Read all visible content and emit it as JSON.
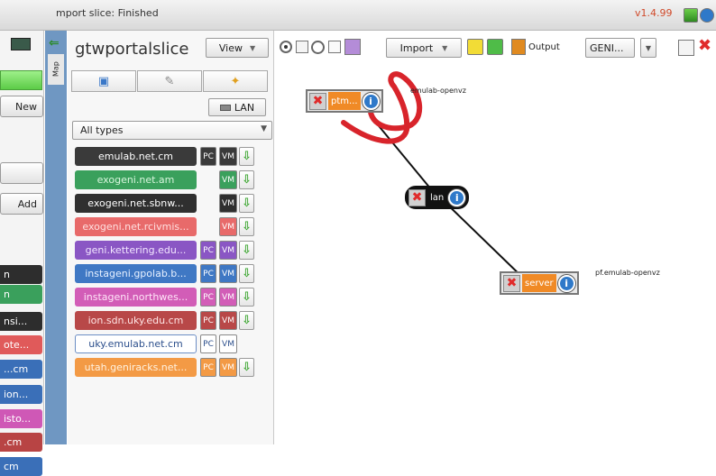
{
  "titlebar": {
    "title": "mport slice: Finished",
    "version": "v1.4.99"
  },
  "left_panel": {
    "new_label": "New",
    "add_label": "Add",
    "chips": [
      {
        "label": "n",
        "color": "#2d2d2d"
      },
      {
        "label": "n",
        "color": "#3aa05c"
      },
      {
        "label": "nsi...",
        "color": "#2d2d2d"
      },
      {
        "label": "ote...",
        "color": "#e05a5a"
      },
      {
        "label": "...cm",
        "color": "#3a6fb8"
      },
      {
        "label": "ion...",
        "color": "#3a6fb8"
      },
      {
        "label": "isto...",
        "color": "#cf58b6"
      },
      {
        "label": ".cm",
        "color": "#b84444"
      },
      {
        "label": "cm",
        "color": "#3a6fb8"
      }
    ]
  },
  "map_strip": {
    "label": "Map"
  },
  "slice_panel": {
    "slice_name": "gtwportalslice",
    "lan_label": "LAN",
    "type_filter": "All types",
    "aggregates": [
      {
        "name": "emulab.net.cm",
        "bg": "#3a3a3a",
        "fg": "#ffffff",
        "pc": "PC",
        "vm": "VM",
        "pc_bg": "#3a3a3a",
        "vm_bg": "#3a3a3a",
        "add": true
      },
      {
        "name": "exogeni.net.am",
        "bg": "#3aa05c",
        "fg": "#d8f5dd",
        "pc": "",
        "vm": "VM",
        "pc_bg": "",
        "vm_bg": "#3aa05c",
        "add": true
      },
      {
        "name": "exogeni.net.sbnw...",
        "bg": "#2f2f2f",
        "fg": "#ffffff",
        "pc": "",
        "vm": "VM",
        "pc_bg": "",
        "vm_bg": "#2f2f2f",
        "add": true
      },
      {
        "name": "exogeni.net.rcivmis...",
        "bg": "#e86a6a",
        "fg": "#ffe0e0",
        "pc": "",
        "vm": "VM",
        "pc_bg": "",
        "vm_bg": "#e86a6a",
        "add": true
      },
      {
        "name": "geni.kettering.edu...",
        "bg": "#8a56c4",
        "fg": "#f2e6ff",
        "pc": "PC",
        "vm": "VM",
        "pc_bg": "#8a56c4",
        "vm_bg": "#8a56c4",
        "add": true
      },
      {
        "name": "instageni.gpolab.b...",
        "bg": "#3f78c4",
        "fg": "#e6f0ff",
        "pc": "PC",
        "vm": "VM",
        "pc_bg": "#3f78c4",
        "vm_bg": "#3f78c4",
        "add": true
      },
      {
        "name": "instageni.northwes...",
        "bg": "#d25db7",
        "fg": "#ffe6f8",
        "pc": "PC",
        "vm": "VM",
        "pc_bg": "#d25db7",
        "vm_bg": "#d25db7",
        "add": true
      },
      {
        "name": "ion.sdn.uky.edu.cm",
        "bg": "#b84848",
        "fg": "#ffe6e6",
        "pc": "PC",
        "vm": "VM",
        "pc_bg": "#b84848",
        "vm_bg": "#b84848",
        "add": true
      },
      {
        "name": "uky.emulab.net.cm",
        "bg": "#ffffff",
        "fg": "#2c4f8c",
        "pc": "PC",
        "vm": "VM",
        "pc_bg": "#ffffff",
        "vm_bg": "#ffffff",
        "add": false
      },
      {
        "name": "utah.geniracks.net...",
        "bg": "#f39a45",
        "fg": "#fff2e0",
        "pc": "PC",
        "vm": "VM",
        "pc_bg": "#f39a45",
        "vm_bg": "#f39a45",
        "add": true
      }
    ]
  },
  "toolbar": {
    "view_label": "View",
    "import_label": "Import",
    "output_label": "Output",
    "format_value": "GENI..."
  },
  "canvas": {
    "nodes": [
      {
        "name": "ptm...",
        "aggregate": "emulab-openvz"
      },
      {
        "name": "lan",
        "aggregate": ""
      },
      {
        "name": "server",
        "aggregate": "pf.emulab-openvz"
      }
    ]
  },
  "colors": {
    "accent_red": "#e02b2b",
    "orange": "#f08a26",
    "info_blue": "#2f79c9",
    "annotation_red": "#d8242b"
  }
}
